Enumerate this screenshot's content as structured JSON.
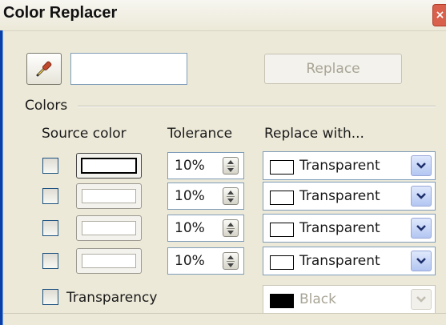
{
  "window": {
    "title": "Color Replacer",
    "close_glyph": "×"
  },
  "toolbar": {
    "pipette_icon": "pipette-icon",
    "replace_label": "Replace"
  },
  "colors_group": {
    "label": "Colors",
    "headers": {
      "source": "Source color",
      "tolerance": "Tolerance",
      "replace_with": "Replace with..."
    },
    "rows": [
      {
        "checked": false,
        "tolerance": "10%",
        "replace": "Transparent"
      },
      {
        "checked": false,
        "tolerance": "10%",
        "replace": "Transparent"
      },
      {
        "checked": false,
        "tolerance": "10%",
        "replace": "Transparent"
      },
      {
        "checked": false,
        "tolerance": "10%",
        "replace": "Transparent"
      }
    ],
    "transparency_label": "Transparency",
    "transparency_checked": false,
    "transparency_color": "Black"
  },
  "colors": {
    "accent": "#0a3fa8",
    "close": "#d9604a",
    "disabled_text": "#a8a596"
  }
}
